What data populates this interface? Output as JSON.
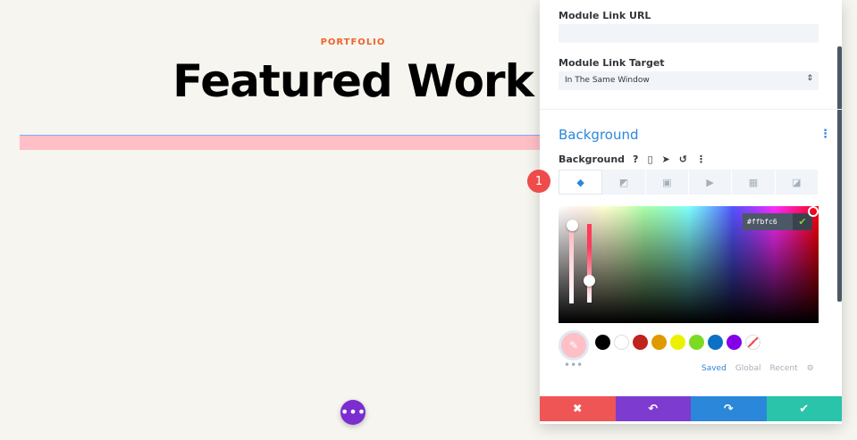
{
  "canvas": {
    "eyebrow": "PORTFOLIO",
    "headline": "Featured Work",
    "fab_icon": "more-horizontal-icon",
    "fab_glyph": "•••",
    "accent_pink": "#ffbfc6"
  },
  "panel": {
    "link_url_label": "Module Link URL",
    "link_url_value": "",
    "link_target_label": "Module Link Target",
    "link_target_value": "In The Same Window",
    "section_title": "Background",
    "section_menu_glyph": "⋮",
    "background_label": "Background",
    "row_icons": [
      {
        "name": "help-icon",
        "glyph": "?"
      },
      {
        "name": "mobile-icon",
        "glyph": "▯"
      },
      {
        "name": "cursor-icon",
        "glyph": "➤"
      },
      {
        "name": "reset-icon",
        "glyph": "↺"
      },
      {
        "name": "more-vertical-icon",
        "glyph": "⋮"
      }
    ],
    "step_badge": "1",
    "tabs": [
      {
        "name": "color-tab",
        "glyph": "◆",
        "active": true
      },
      {
        "name": "gradient-tab",
        "glyph": "◩",
        "active": false
      },
      {
        "name": "image-tab",
        "glyph": "▣",
        "active": false
      },
      {
        "name": "video-tab",
        "glyph": "▶",
        "active": false
      },
      {
        "name": "pattern-tab",
        "glyph": "▦",
        "active": false
      },
      {
        "name": "mask-tab",
        "glyph": "◪",
        "active": false
      }
    ],
    "hex_value": "#ffbfc6",
    "hex_ok_glyph": "✔",
    "eyedropper_glyph": "✎",
    "more_glyph": "•••",
    "swatches": [
      "#000000",
      "#ffffff",
      "#c0231c",
      "#e09900",
      "#edf000",
      "#7cda24",
      "#0c71c3",
      "#8300e9",
      "none"
    ],
    "palette_modes": [
      "Saved",
      "Global",
      "Recent"
    ],
    "active_palette": "Saved",
    "settings_glyph": "⚙",
    "footer": [
      {
        "name": "cancel-button",
        "glyph": "✖",
        "color": "#ef5555"
      },
      {
        "name": "undo-button",
        "glyph": "↶",
        "color": "#7e3bd0"
      },
      {
        "name": "redo-button",
        "glyph": "↷",
        "color": "#2b87da"
      },
      {
        "name": "save-button",
        "glyph": "✔",
        "color": "#29c4a9"
      }
    ]
  }
}
